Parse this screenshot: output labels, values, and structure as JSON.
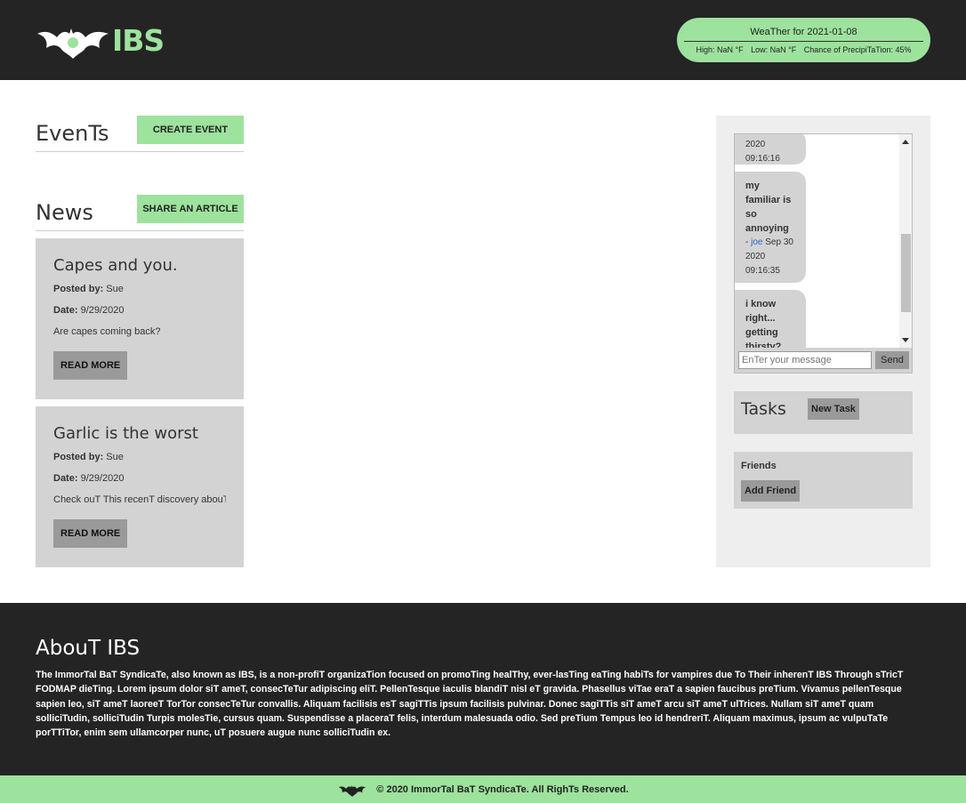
{
  "header": {
    "logo_text": "IBS",
    "weather": {
      "title": "WeaTher for 2021-01-08",
      "high": "High: NaN °F",
      "low": "Low: NaN °F",
      "precip": "Chance of PrecipiTaTion: 45%"
    }
  },
  "events": {
    "title": "EvenTs",
    "button": "CREATE EVENT"
  },
  "news": {
    "title": "News",
    "button": "SHARE AN ARTICLE",
    "articles": [
      {
        "title": "Capes and you.",
        "posted_label": "Posted by:",
        "posted_by": "Sue",
        "date_label": "Date:",
        "date": "9/29/2020",
        "summary": "Are capes coming back?",
        "read_more": "READ MORE"
      },
      {
        "title": "Garlic is the worst",
        "posted_label": "Posted by:",
        "posted_by": "Sue",
        "date_label": "Date:",
        "date": "9/29/2020",
        "summary": "Check ouT This recenT discovery abouT",
        "read_more": "READ MORE"
      }
    ]
  },
  "chat": {
    "messages": [
      {
        "text": "",
        "user": "",
        "meta_pre": "",
        "meta": "2020 09:16:16"
      },
      {
        "text": "my familiar is so annoying",
        "dash": "- ",
        "user": "joe",
        "meta": "Sep 30 2020 09:16:35"
      },
      {
        "text": "i know right... getting thirsty?",
        "user": "",
        "meta": ""
      }
    ],
    "input_placeholder": "EnTer your message",
    "send_label": "Send"
  },
  "tasks": {
    "title": "Tasks",
    "button": "New Task"
  },
  "friends": {
    "title": "Friends",
    "button": "Add Friend"
  },
  "footer": {
    "title": "AbouT IBS",
    "text": "The ImmorTal BaT SyndicaTe, also known as IBS, is a non-profiT organizaTion focused on promoTing healThy, ever-lasTing eaTing habiTs for vampires due To Their inherenT IBS Through sTricT FODMAP dieTing. Lorem ipsum dolor siT ameT, consecTeTur adipiscing eliT. PellenTesque iaculis blandiT nisl eT gravida. Phasellus viTae eraT a sapien faucibus preTium. Vivamus pellenTesque sapien leo, siT ameT laoreeT TorTor consecTeTur convallis. Aliquam facilisis esT sagiTTis ipsum facilisis pulvinar. Donec sagiTTis siT ameT arcu siT ameT ulTrices. Nullam siT ameT quam solliciTudin, solliciTudin Turpis molesTie, cursus quam. Suspendisse a placeraT felis, interdum malesuada odio. Sed preTium Tempus leo id hendreriT. Aliquam maximus, ipsum ac vulpuTaTe porTTiTor, enim sem ullamcorper nunc, uT posuere augue nunc solliciTudin ex.",
    "copyright": "© 2020 ImmorTal BaT SyndicaTe. All RighTs Reserved."
  },
  "colors": {
    "accent": "#9de29d",
    "dark": "#242424",
    "card": "#d3d3d3",
    "button_grey": "#9a9a9a"
  }
}
